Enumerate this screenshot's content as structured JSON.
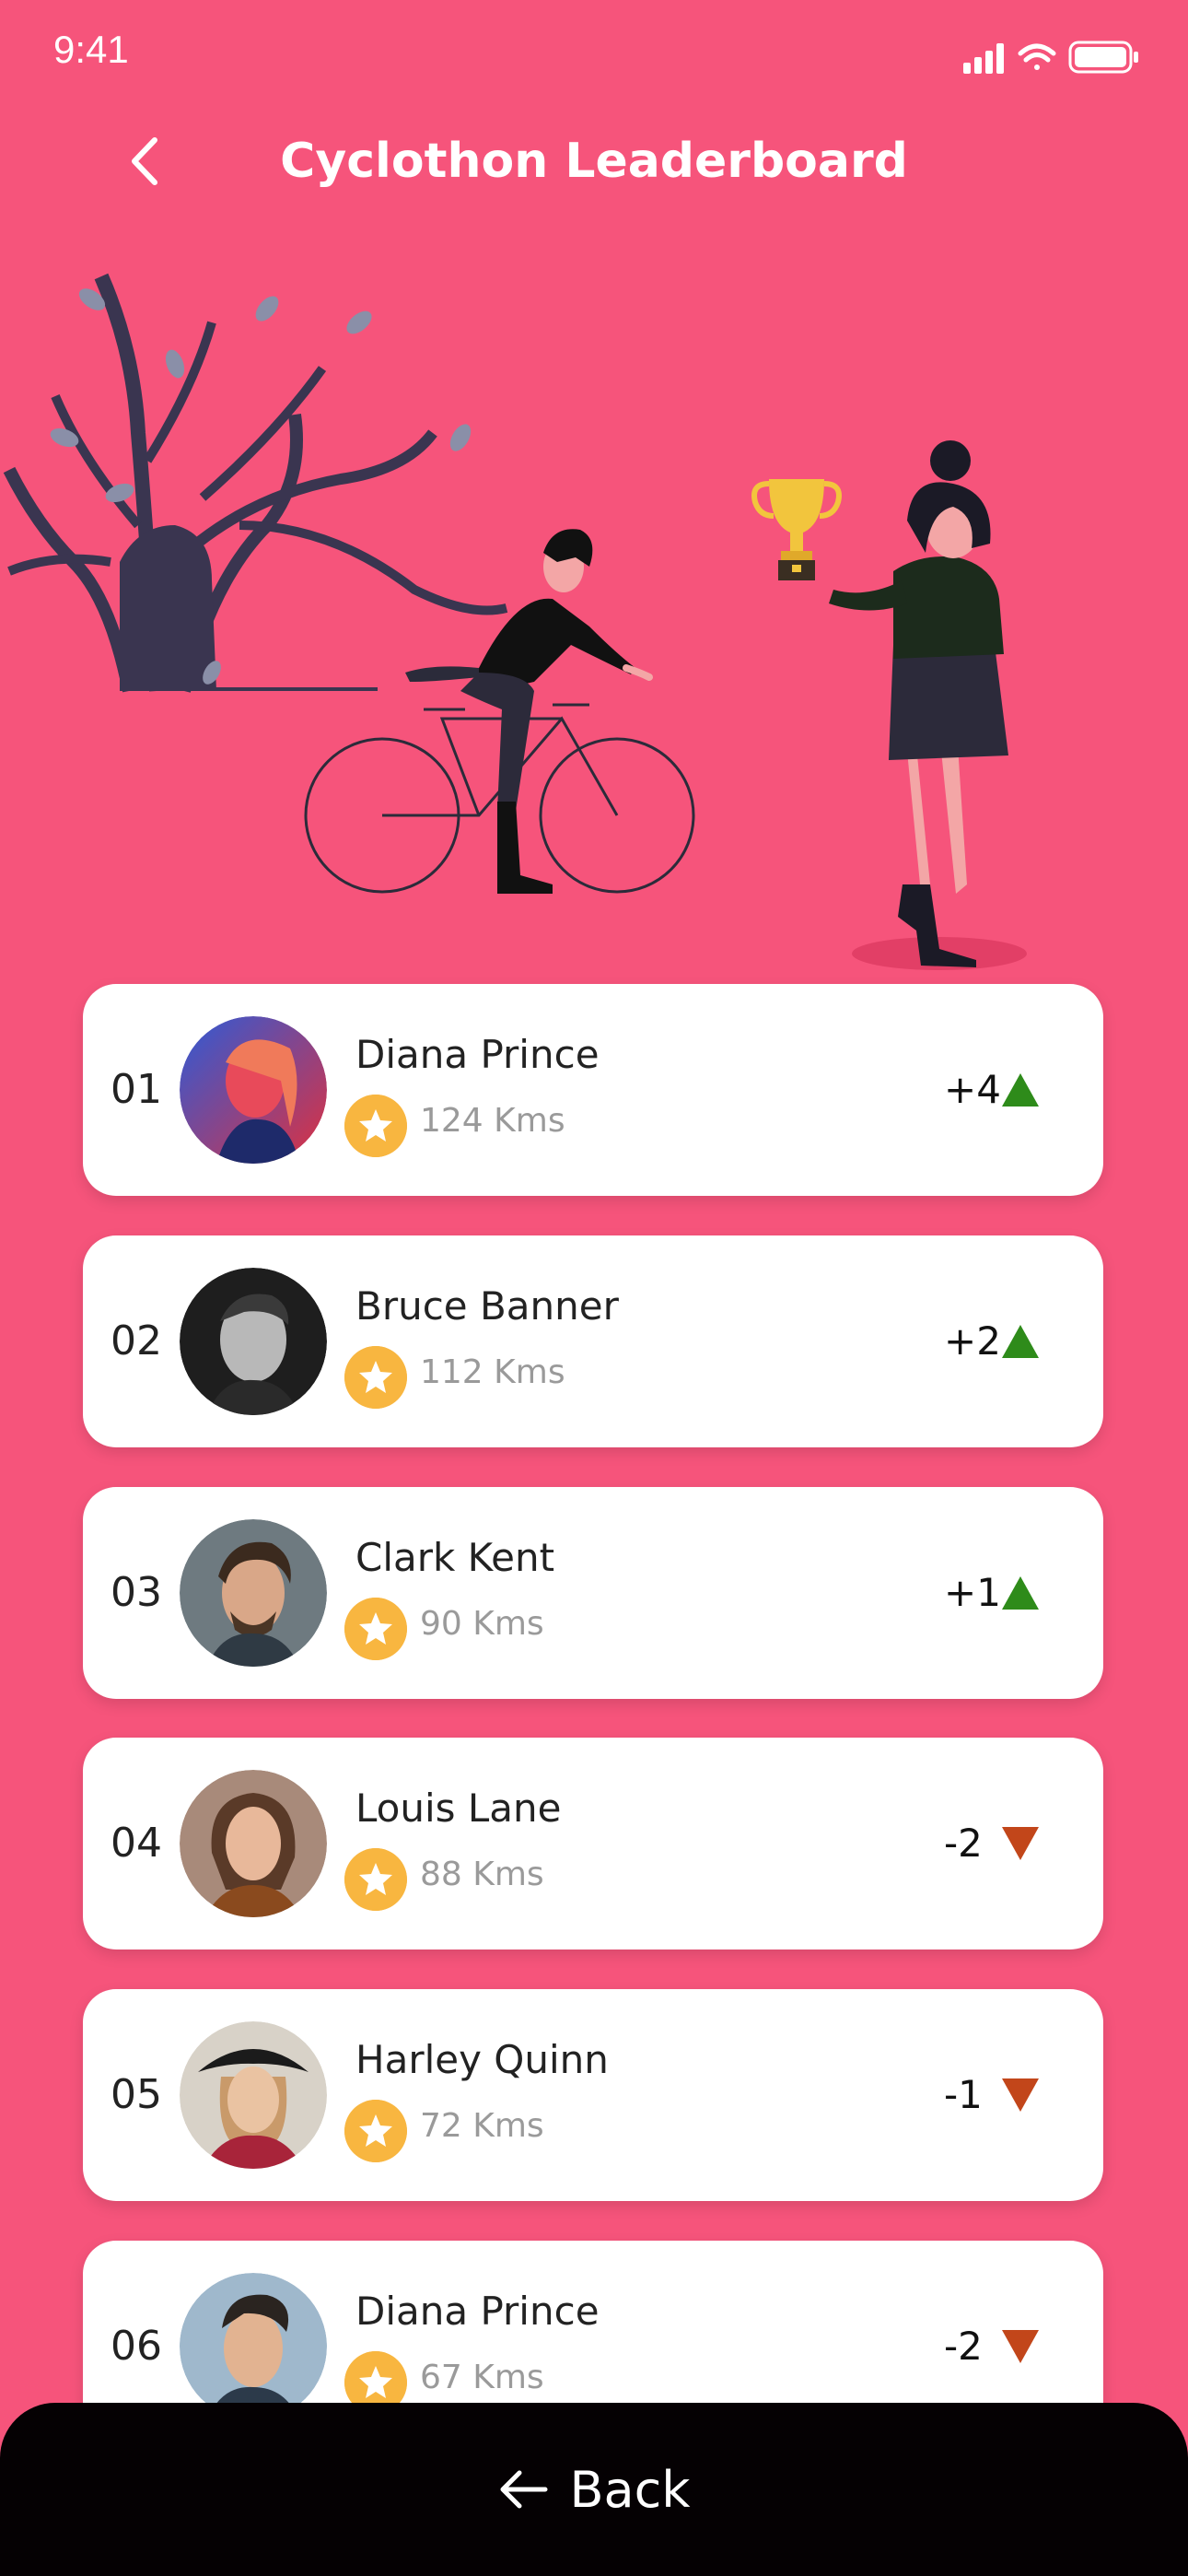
{
  "status_bar": {
    "time": "9:41"
  },
  "header": {
    "title": "Cyclothon Leaderboard"
  },
  "leaderboard": [
    {
      "rank": "01",
      "name": "Diana Prince",
      "distance": "124 Kms",
      "change": "+4",
      "trend": "up"
    },
    {
      "rank": "02",
      "name": "Bruce Banner",
      "distance": "112 Kms",
      "change": "+2",
      "trend": "up"
    },
    {
      "rank": "03",
      "name": "Clark Kent",
      "distance": "90 Kms",
      "change": "+1",
      "trend": "up"
    },
    {
      "rank": "04",
      "name": "Louis Lane",
      "distance": "88 Kms",
      "change": "-2",
      "trend": "down"
    },
    {
      "rank": "05",
      "name": "Harley Quinn",
      "distance": "72 Kms",
      "change": "-1",
      "trend": "down"
    },
    {
      "rank": "06",
      "name": "Diana Prince",
      "distance": "67 Kms",
      "change": "-2",
      "trend": "down"
    }
  ],
  "footer": {
    "back_label": "Back"
  },
  "colors": {
    "background": "#F6547B",
    "card": "#FFFFFF",
    "badge": "#F8B640",
    "trend_up": "#2E8B1A",
    "trend_down": "#C2461A",
    "bottom_bar": "#050103"
  },
  "icons": {
    "back": "chevron-left-icon",
    "star": "star-icon",
    "trend_up": "triangle-up-icon",
    "trend_down": "triangle-down-icon",
    "footer_back": "arrow-left-icon"
  }
}
